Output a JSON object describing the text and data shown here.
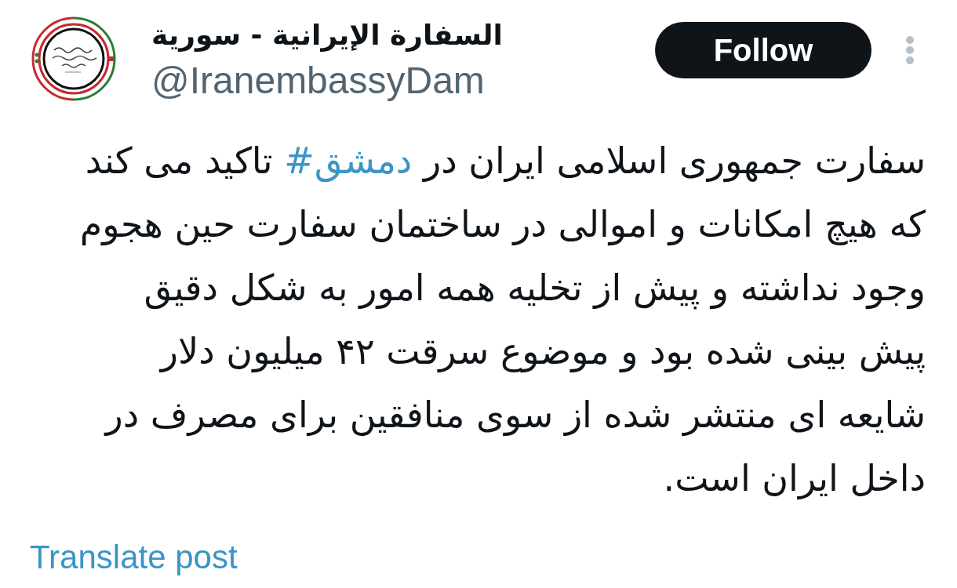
{
  "author": {
    "display_name": "السفارة الإيرانية - سورية",
    "handle": "@IranembassyDam"
  },
  "follow_button": {
    "label": "Follow"
  },
  "post": {
    "text": [
      {
        "kind": "plain",
        "text": "سفارت جمهوری اسلامی ایران در "
      },
      {
        "kind": "hashtag",
        "text": "#دمشق"
      },
      {
        "kind": "plain",
        "text": " تاکید می کند\nکه هیچ امکانات و اموالی در ساختمان سفارت حین هجوم\nوجود نداشته و پیش از تخلیه همه امور به شکل دقیق\nپیش بینی شده بود و موضوع سرقت ۴۲ میلیون دلار\nشایعه ای منتشر شده از سوی منافقین برای مصرف در\nداخل ایران است."
      }
    ]
  },
  "translate_link": "Translate post"
}
